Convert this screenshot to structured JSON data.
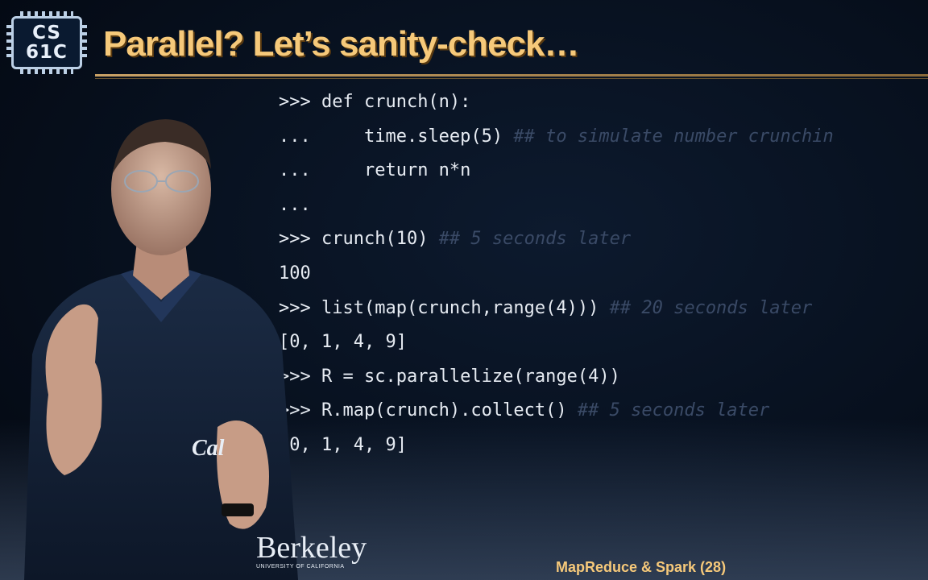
{
  "logo": {
    "line1": "CS",
    "line2": "61C"
  },
  "title": "Parallel? Let’s sanity-check…",
  "code": [
    {
      "prompt": ">>> ",
      "code": "def crunch(n):",
      "comment": ""
    },
    {
      "prompt": "...     ",
      "code": "time.sleep(5) ",
      "comment": "## to simulate number crunchin"
    },
    {
      "prompt": "...     ",
      "code": "return n*n",
      "comment": ""
    },
    {
      "prompt": "...",
      "code": "",
      "comment": ""
    },
    {
      "prompt": ">>> ",
      "code": "crunch(10) ",
      "comment": "## 5 seconds later"
    },
    {
      "prompt": "",
      "code": "100",
      "comment": ""
    },
    {
      "prompt": ">>> ",
      "code": "list(map(crunch,range(4))) ",
      "comment": "## 20 seconds later"
    },
    {
      "prompt": "",
      "code": "[0, 1, 4, 9]",
      "comment": ""
    },
    {
      "prompt": ">>> ",
      "code": "R = sc.parallelize(range(4))",
      "comment": ""
    },
    {
      "prompt": ">>> ",
      "code": "R.map(crunch).collect() ",
      "comment": "## 5 seconds later"
    },
    {
      "prompt": "",
      "code": "[0, 1, 4, 9]",
      "comment": ""
    }
  ],
  "berkeley": {
    "name": "Berkeley",
    "sub": "UNIVERSITY OF CALIFORNIA"
  },
  "footer": "MapReduce & Spark (28)",
  "colors": {
    "title": "#f6c97a",
    "code": "#e6ebf2",
    "comment": "#3a4a66",
    "background": "#07101e"
  }
}
